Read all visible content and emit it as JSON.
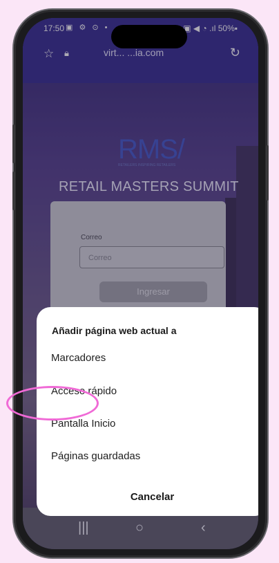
{
  "status_bar": {
    "time": "17:50",
    "left_icons": "▣ ⚙ ⊙ •",
    "right_text": "▣ ◀ ◔ .ıl 50%▪"
  },
  "browser": {
    "url": "virt... ...ia.com",
    "icons": [
      "star-icon",
      "lock-icon",
      "reload-icon"
    ]
  },
  "page": {
    "logo_text": "RMS/",
    "logo_subtext": "RETAILERS INSPIRING RETAILERS",
    "event_title": "RETAIL MASTERS SUMMIT",
    "login": {
      "email_label": "Correo",
      "email_placeholder": "Correo",
      "submit_label": "Ingresar"
    }
  },
  "sheet": {
    "title": "Añadir página web actual a",
    "options": [
      "Marcadores",
      "Acceso rápido",
      "Pantalla Inicio",
      "Páginas guardadas"
    ],
    "cancel_label": "Cancelar",
    "highlighted_option": "Pantalla Inicio",
    "highlight_color": "#f06ad6"
  },
  "nav_bar": {
    "recent": "|||",
    "home": "○",
    "back": "‹"
  },
  "colors": {
    "browser_bar": "#3d3394",
    "page_bg": "#fbe6f7",
    "logo": "#4a5ecb"
  }
}
